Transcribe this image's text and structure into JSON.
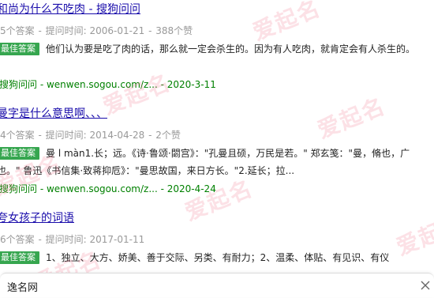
{
  "results": [
    {
      "title": "和尚为什么不吃肉 - 搜狗问问",
      "answers_count": "5个答案",
      "time_label": "提问时间:",
      "time": "2006-01-21",
      "likes": "388个赞",
      "badge": "最佳答案",
      "answer": "他们认为要是吃了肉的话，那么就一定会杀生的。因为有人吃肉，就肯定会有人杀生的。",
      "source": "搜狗问问 - wenwen.sogou.com/z... - 2020-3-11"
    },
    {
      "title": "曼字是什么意思啊、、、",
      "answers_count": "4个答案",
      "time_label": "提问时间:",
      "time": "2014-04-28",
      "likes": "2个赞",
      "badge": "最佳答案",
      "answer": "曼 l màn1.长；远。《诗·鲁颂·閟宫》：\"孔曼且硕，万民是若。\" 郑玄笺：\"曼，脩也，广也。\" 鲁迅《书信集·致蒋抑卮》：\"曼思故国，来日方长。\"2.延长；拉...",
      "source": "搜狗问问 - wenwen.sogou.com/z... - 2020-4-24"
    },
    {
      "title": "夸女孩子的词语",
      "answers_count": "6个答案",
      "time_label": "提问时间:",
      "time": "2017-01-11",
      "likes": "",
      "badge": "最佳答案",
      "answer": "1、独立、大方、娇美、善于交际、另类、有耐力；2、温柔、体贴、有见识、有仪",
      "source": ""
    }
  ],
  "watermark_text": "爱起名",
  "footer": {
    "label": "逸名网"
  }
}
